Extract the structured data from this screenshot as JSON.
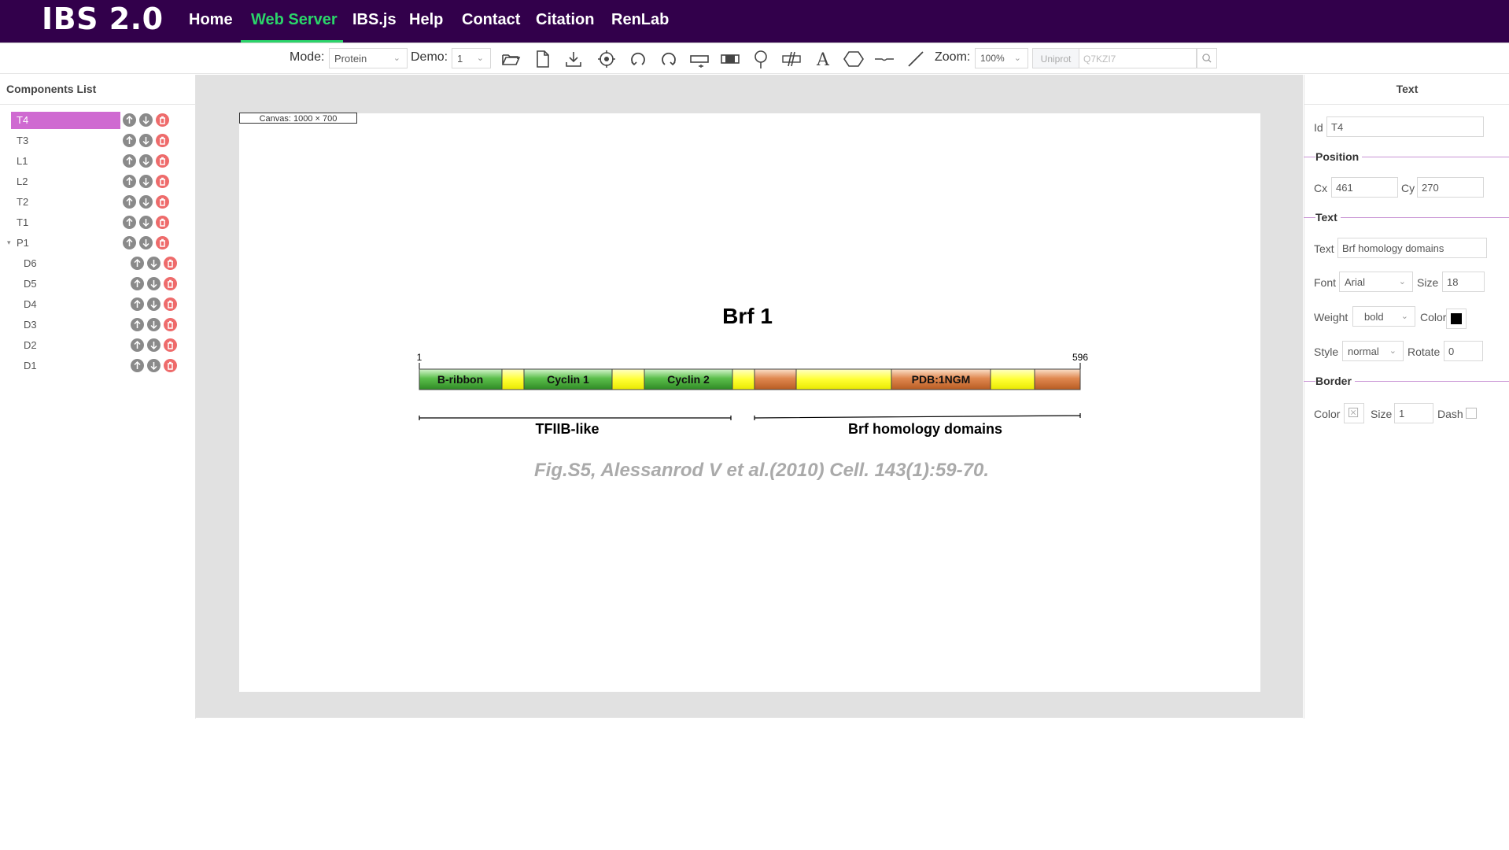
{
  "header": {
    "logo": "IBS 2.0",
    "nav": [
      "Home",
      "Web Server",
      "IBS.js",
      "Help",
      "Contact",
      "Citation",
      "RenLab"
    ],
    "active_nav": "Web Server",
    "brand_color": "#32004b",
    "accent_color": "#2bd56a"
  },
  "toolbar": {
    "mode_label": "Mode:",
    "mode_value": "Protein",
    "demo_label": "Demo:",
    "demo_value": "1",
    "zoom_label": "Zoom:",
    "zoom_value": "100%",
    "uniprot_button": "Uniprot",
    "uniprot_placeholder": "Q7KZI7",
    "icons": [
      "open-folder-icon",
      "new-file-icon",
      "download-icon",
      "target-icon",
      "rotate-left-icon",
      "rotate-right-icon",
      "protein-icon",
      "domain-icon",
      "marker-icon",
      "break-icon",
      "text-icon",
      "hexagon-icon",
      "bond-icon",
      "line-icon"
    ]
  },
  "components": {
    "title": "Components List",
    "items": [
      {
        "label": "T4",
        "selected": true
      },
      {
        "label": "T3"
      },
      {
        "label": "L1"
      },
      {
        "label": "L2"
      },
      {
        "label": "T2"
      },
      {
        "label": "T1"
      },
      {
        "label": "P1",
        "expandable": true
      },
      {
        "label": "D6"
      },
      {
        "label": "D5"
      },
      {
        "label": "D4"
      },
      {
        "label": "D3"
      },
      {
        "label": "D2"
      },
      {
        "label": "D1"
      }
    ],
    "selected_color": "#cf6ad1"
  },
  "canvas": {
    "size_label": "Canvas: 1000 × 700",
    "title": "Brf 1",
    "start_label": "1",
    "end_label": "596",
    "domains": [
      {
        "label": "B-ribbon",
        "color": "#4caf3f"
      },
      {
        "label": "Cyclin 1",
        "color": "#4caf3f"
      },
      {
        "label": "Cyclin 2",
        "color": "#4caf3f"
      },
      {
        "label": "",
        "color": "#d9763a"
      },
      {
        "label": "PDB:1NGM",
        "color": "#d9763a"
      },
      {
        "label": "",
        "color": "#d9763a"
      }
    ],
    "backbone_color": "#ffff33",
    "bracket_left_label": "TFIIB-like",
    "bracket_right_label": "Brf homology domains",
    "citation": "Fig.S5, Alessanrod V et al.(2010) Cell. 143(1):59-70."
  },
  "properties": {
    "title": "Text",
    "id_label": "Id",
    "id_value": "T4",
    "position_section": "Position",
    "cx_label": "Cx",
    "cx_value": "461",
    "cy_label": "Cy",
    "cy_value": "270",
    "text_section": "Text",
    "text_label": "Text",
    "text_value": "Brf homology domains",
    "font_label": "Font",
    "font_value": "Arial",
    "size_label": "Size",
    "size_value": "18",
    "weight_label": "Weight",
    "weight_value": "bold",
    "color_label": "Color",
    "text_color": "#000000",
    "style_label": "Style",
    "style_value": "normal",
    "rotate_label": "Rotate",
    "rotate_value": "0",
    "border_section": "Border",
    "border_color_label": "Color",
    "border_size_label": "Size",
    "border_size_value": "1",
    "dash_label": "Dash"
  }
}
